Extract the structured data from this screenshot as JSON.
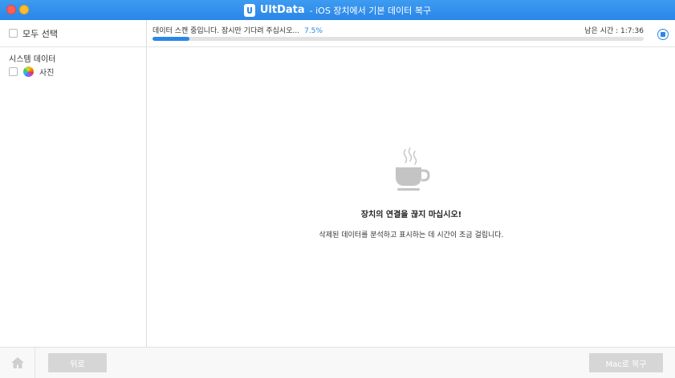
{
  "window": {
    "title_brand": "UltData",
    "title_rest": "- iOS 장치에서 기본 데이터 복구"
  },
  "sidebar": {
    "select_all_label": "모두 선택",
    "section_title": "시스템 데이터",
    "items": [
      {
        "label": "사진",
        "icon": "photos-icon",
        "checked": false
      }
    ]
  },
  "scan": {
    "status_text": "데이터 스캔 중입니다. 잠시만 기다려 주십시오...",
    "percent_text": "7.5%",
    "progress": 0.075,
    "remaining_label": "남은 시간 :",
    "remaining_time": "1:7:36"
  },
  "main": {
    "icon": "coffee-cup-icon",
    "message_title": "장치의 연결을 끊지 마십시오!",
    "message_sub": "삭제된 데이터를 분석하고 표시하는 데 시간이 조금 걸립니다."
  },
  "footer": {
    "back_label": "뒤로",
    "restore_label": "Mac로 복구"
  },
  "colors": {
    "accent": "#2a86e8",
    "titlebar": "#3d9bf0",
    "disabled_button": "#d6d6d6"
  }
}
